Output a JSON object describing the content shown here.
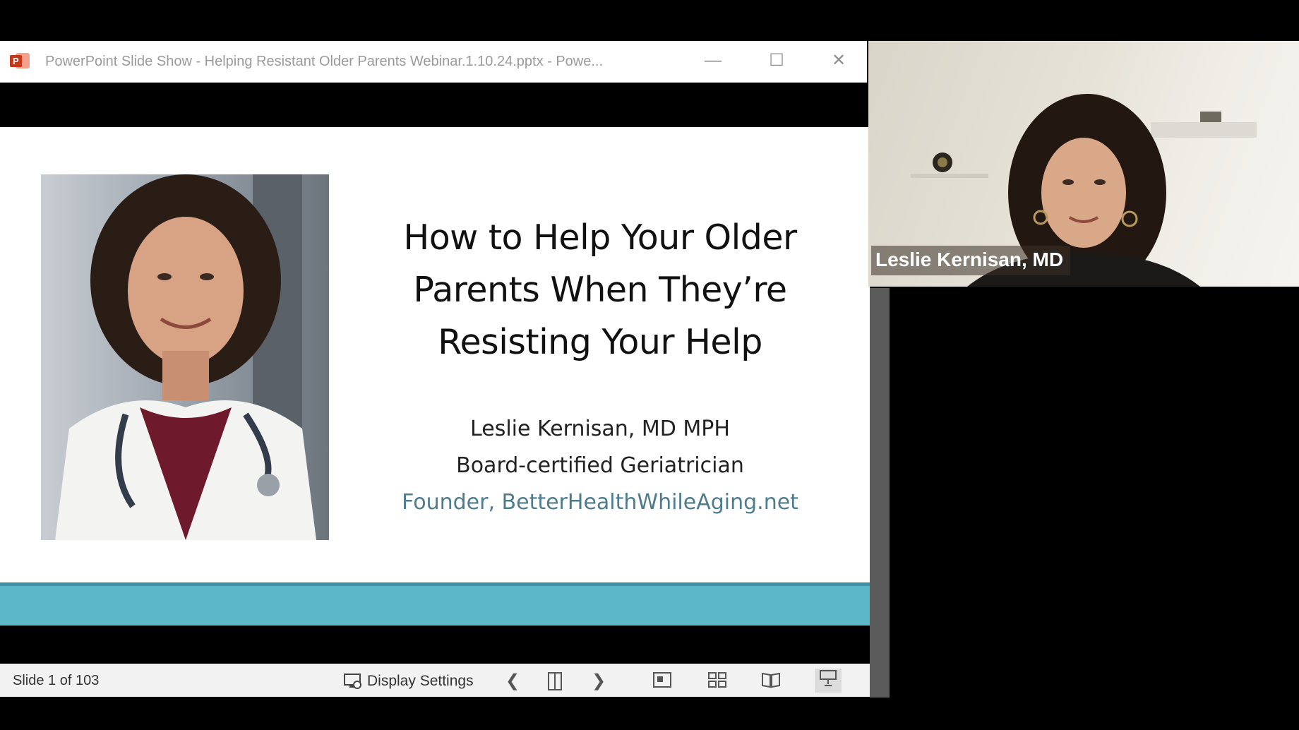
{
  "window": {
    "title": "PowerPoint Slide Show  -  Helping Resistant Older Parents Webinar.1.10.24.pptx  -  Powe...",
    "minimize_symbol": "—",
    "maximize_symbol": "☐",
    "close_symbol": "✕"
  },
  "slide": {
    "title_lines": [
      "How to Help Your Older",
      "Parents When They’re",
      "Resisting Your Help"
    ],
    "presenter_line": "Leslie Kernisan, MD MPH",
    "role_line": "Board-certified Geriatrician",
    "founder_line": "Founder, BetterHealthWhileAging.net",
    "accent_band_color": "#5cb8c8"
  },
  "status_bar": {
    "slide_counter": "Slide 1 of 103",
    "display_settings_label": "Display Settings",
    "icons": [
      "display-settings-icon",
      "previous-slide-icon",
      "slide-page-icon",
      "next-slide-icon",
      "normal-view-icon",
      "slide-sorter-icon",
      "reading-view-icon",
      "slideshow-icon"
    ]
  },
  "webcam": {
    "participant_name": "Leslie Kernisan, MD"
  }
}
